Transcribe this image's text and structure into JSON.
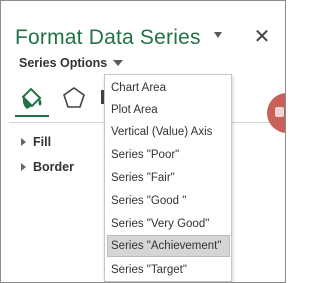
{
  "pane": {
    "title": "Format Data Series",
    "close_label": "✕"
  },
  "series_options": {
    "label": "Series Options"
  },
  "tabs": [
    {
      "icon": "fill-line-icon"
    },
    {
      "icon": "effects-icon"
    },
    {
      "icon": "series-options-icon"
    }
  ],
  "sections": [
    {
      "label": "Fill"
    },
    {
      "label": "Border"
    }
  ],
  "menu": {
    "items": [
      {
        "label": "Chart Area"
      },
      {
        "label": "Plot Area"
      },
      {
        "label": "Vertical (Value) Axis"
      },
      {
        "label": "Series \"Poor\""
      },
      {
        "label": "Series \"Fair\""
      },
      {
        "label": "Series \"Good \""
      },
      {
        "label": "Series \"Very Good\""
      },
      {
        "label": "Series \"Achievement\""
      },
      {
        "label": "Series \"Target\""
      }
    ],
    "selected": "Series \"Achievement\""
  },
  "colors": {
    "accent": "#217346",
    "menu_selected": "#d5d5d5",
    "side_blob": "#c9605a"
  }
}
